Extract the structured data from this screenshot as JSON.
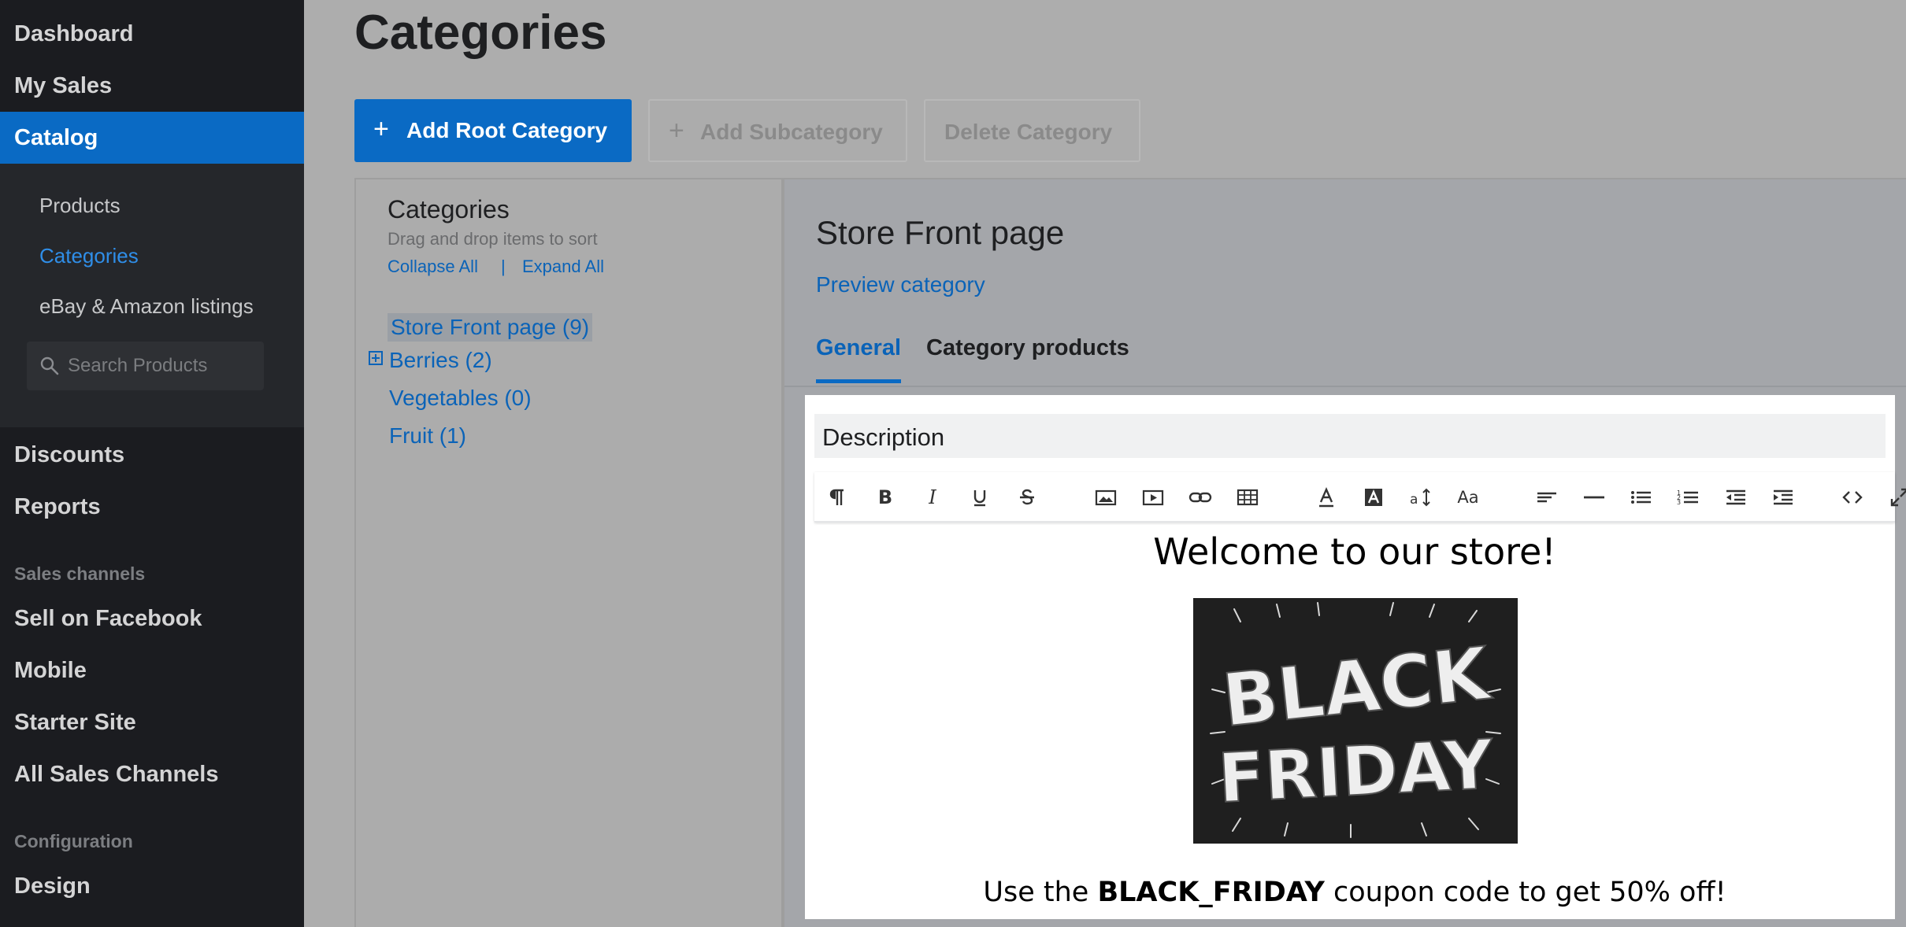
{
  "sidebar": {
    "top_items": [
      "Dashboard",
      "My Sales"
    ],
    "catalog_label": "Catalog",
    "catalog_sub": [
      "Products",
      "Categories",
      "eBay & Amazon listings"
    ],
    "search_placeholder": "Search Products",
    "main_items": [
      "Discounts",
      "Reports"
    ],
    "section_sales_channels": "Sales channels",
    "channel_items": [
      "Sell on Facebook",
      "Mobile",
      "Starter Site",
      "All Sales Channels"
    ],
    "section_configuration": "Configuration",
    "config_items": [
      "Design"
    ]
  },
  "header": {
    "title": "Categories",
    "add_root": "Add Root Category",
    "add_sub": "Add Subcategory",
    "delete": "Delete Category"
  },
  "categories_panel": {
    "heading": "Categories",
    "subtext": "Drag and drop items to sort",
    "collapse_all": "Collapse All",
    "separator": "|",
    "expand_all": "Expand All",
    "tree": [
      "Store Front page (9)",
      "Berries (2)",
      "Vegetables (0)",
      "Fruit (1)"
    ]
  },
  "detail": {
    "title": "Store Front page",
    "preview": "Preview category",
    "tabs": [
      "General",
      "Category products"
    ]
  },
  "editor": {
    "label": "Description",
    "toolbar_icons": [
      "paragraph-icon",
      "bold-icon",
      "italic-icon",
      "underline-icon",
      "strikethrough-icon",
      "image-icon",
      "video-icon",
      "link-icon",
      "table-icon",
      "font-color-icon",
      "background-color-icon",
      "font-size-icon",
      "font-family-icon",
      "align-icon",
      "horizontal-rule-icon",
      "bullet-list-icon",
      "numbered-list-icon",
      "outdent-icon",
      "indent-icon",
      "code-view-icon",
      "fullscreen-icon"
    ],
    "headline": "Welcome to our store!",
    "image_text_line1": "BLACK",
    "image_text_line2": "FRIDAY",
    "coupon_prefix": "Use the ",
    "coupon_code": "BLACK_FRIDAY",
    "coupon_suffix": " coupon code to get 50% off!"
  },
  "colors": {
    "accent": "#0a6ac4",
    "link": "#0a63b8",
    "sidebar_bg": "#1b1c20"
  }
}
